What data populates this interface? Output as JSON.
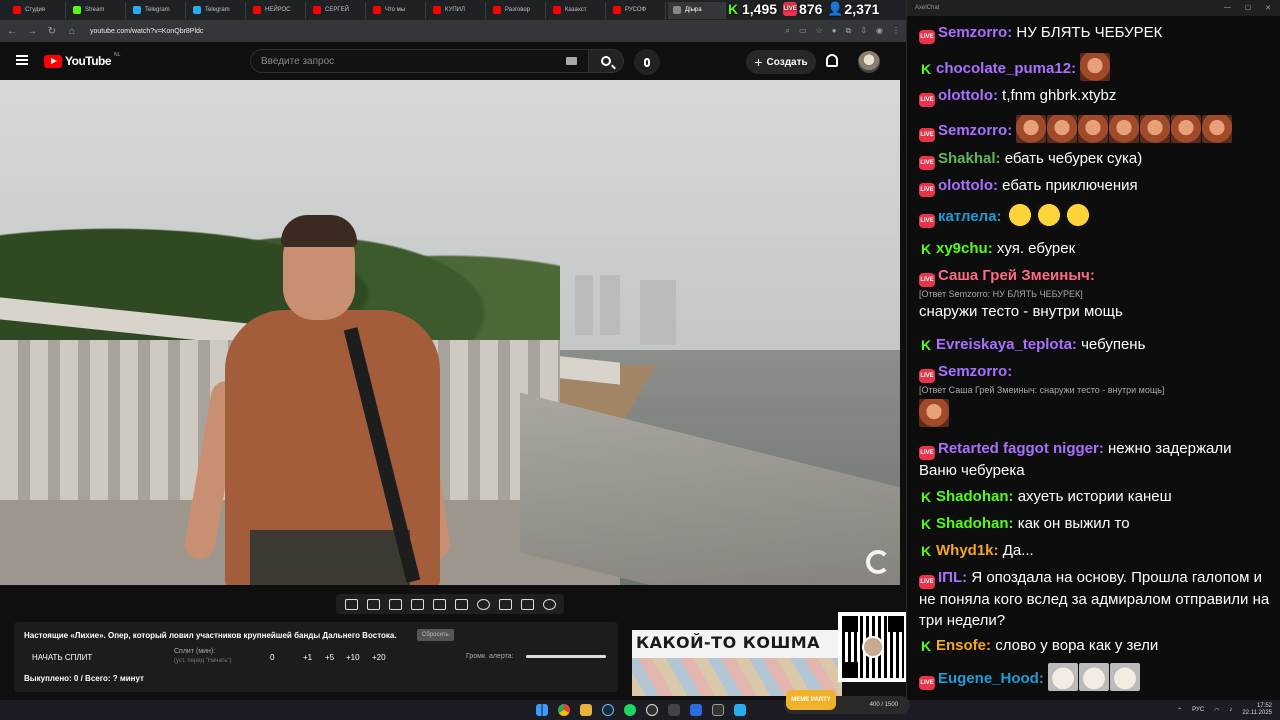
{
  "browser": {
    "tabs": [
      {
        "label": "Студия",
        "color": "#ff0000"
      },
      {
        "label": "Stream",
        "color": "#53fc18"
      },
      {
        "label": "Telegram",
        "color": "#2aabee"
      },
      {
        "label": "Telegram",
        "color": "#2aabee"
      },
      {
        "label": "НЕЙРОС",
        "color": "#ff0000"
      },
      {
        "label": "СЕРГЕЙ",
        "color": "#ff0000"
      },
      {
        "label": "Что мы",
        "color": "#ff0000"
      },
      {
        "label": "КУПИЛ",
        "color": "#ff0000"
      },
      {
        "label": "Разговор",
        "color": "#ff0000"
      },
      {
        "label": "Казахст",
        "color": "#ff0000"
      },
      {
        "label": "РУСОФ",
        "color": "#ff0000"
      },
      {
        "label": "Д|ыра",
        "color": "#888888"
      }
    ],
    "url": "youtube.com/watch?v=KonQbr8Pldc"
  },
  "counters": {
    "kick": "1,495",
    "live": "876",
    "viewers": "2,371"
  },
  "youtube": {
    "logo_text": "YouTube",
    "region": "NL",
    "search_placeholder": "Введите запрос",
    "create_label": "Создать"
  },
  "split_panel": {
    "title": "Настоящие «Лихие». Опер, который ловил участников крупнейшей банды Дальнего Востока.",
    "reset_label": "Сбросить",
    "start_label": "НАЧАТЬ СПЛИТ",
    "split_label": "Сплит (мин):",
    "split_hint": "(уст. перед \"Начать\")",
    "split_value": "0",
    "increments": [
      "+1",
      "+5",
      "+10",
      "+20"
    ],
    "volume_label": "Громк. алерта:",
    "volume_level": 1.0,
    "bought": "Выкуплено: 0 / Всего: ? минут"
  },
  "banner": {
    "text": "КАКОЙ-ТО КОШМА"
  },
  "chat": {
    "window_title": "AxelChat",
    "messages": [
      {
        "platform": "live",
        "nick": "Semzorro",
        "color": "#a970ff",
        "text": "НУ БЛЯТЬ ЧЕБУРЕК",
        "emotes": 0
      },
      {
        "platform": "kick",
        "nick": "chocolate_puma12",
        "color": "#a970ff",
        "text": "",
        "emotes": 1,
        "emote": "face"
      },
      {
        "platform": "live",
        "nick": "olottolo",
        "color": "#a970ff",
        "text": "t,fnm ghbrk.xtybz",
        "emotes": 0
      },
      {
        "platform": "live",
        "nick": "Semzorro",
        "color": "#a970ff",
        "text": "",
        "emotes": 7,
        "emote": "face"
      },
      {
        "platform": "live",
        "nick": "Shakhal",
        "color": "#5fb85f",
        "text": "ебать чебурек сука)",
        "emotes": 0
      },
      {
        "platform": "live",
        "nick": "olottolo",
        "color": "#a970ff",
        "text": "ебать приключения",
        "emotes": 0
      },
      {
        "platform": "live",
        "nick": "катлела",
        "color": "#1e9cd6",
        "text": "",
        "emotes": 3,
        "emote": "laugh"
      },
      {
        "platform": "kick",
        "nick": "xy9chu",
        "color": "#53fc18",
        "text": "хуя. ебурек",
        "emotes": 0
      },
      {
        "platform": "live",
        "nick": "Саша Грей Змеиныч",
        "color": "#ff6b81",
        "reply": "[Ответ Semzorro: НУ БЛЯТЬ ЧЕБУРЕК]",
        "text": "снаружи тесто - внутри мощь",
        "emotes": 0
      },
      {
        "platform": "kick",
        "nick": "Evreiskaya_teplota",
        "color": "#a970ff",
        "text": "чебупень",
        "emotes": 0
      },
      {
        "platform": "live",
        "nick": "Semzorro",
        "color": "#a970ff",
        "reply": "[Ответ Саша Грей Змеиныч: снаружи тесто - внутри мощь]",
        "text": "",
        "emotes": 1,
        "emote": "face"
      },
      {
        "platform": "live",
        "nick": "Retarted faggot nigger",
        "color": "#a970ff",
        "text": "нежно задержали Ваню чебурека",
        "emotes": 0
      },
      {
        "platform": "kick",
        "nick": "Shadohan",
        "color": "#53fc18",
        "text": "ахуеть истории канеш",
        "emotes": 0
      },
      {
        "platform": "kick",
        "nick": "Shadohan",
        "color": "#53fc18",
        "text": "как он выжил то",
        "emotes": 0
      },
      {
        "platform": "kick",
        "nick": "Whyd1k",
        "color": "#f5a623",
        "text": "Да...",
        "emotes": 0
      },
      {
        "platform": "live",
        "nick": "IΠL",
        "color": "#a970ff",
        "text": "Я опоздала на основу. Прошла галопом и не поняла кого вслед за адмиралом отправили на три недели?",
        "emotes": 0
      },
      {
        "platform": "kick",
        "nick": "Ensofe",
        "color": "#f5a623",
        "text": "слово у вора как у зели",
        "emotes": 0
      },
      {
        "platform": "live",
        "nick": "Eugene_Hood",
        "color": "#1e9cd6",
        "text": "",
        "emotes": 3,
        "emote": "cat"
      }
    ]
  },
  "taskbar": {
    "overlay_value": "400 / 1500",
    "party_label": "MEME PARTY",
    "lang": "РУС",
    "time": "17:52",
    "date": "22.11.2025"
  }
}
